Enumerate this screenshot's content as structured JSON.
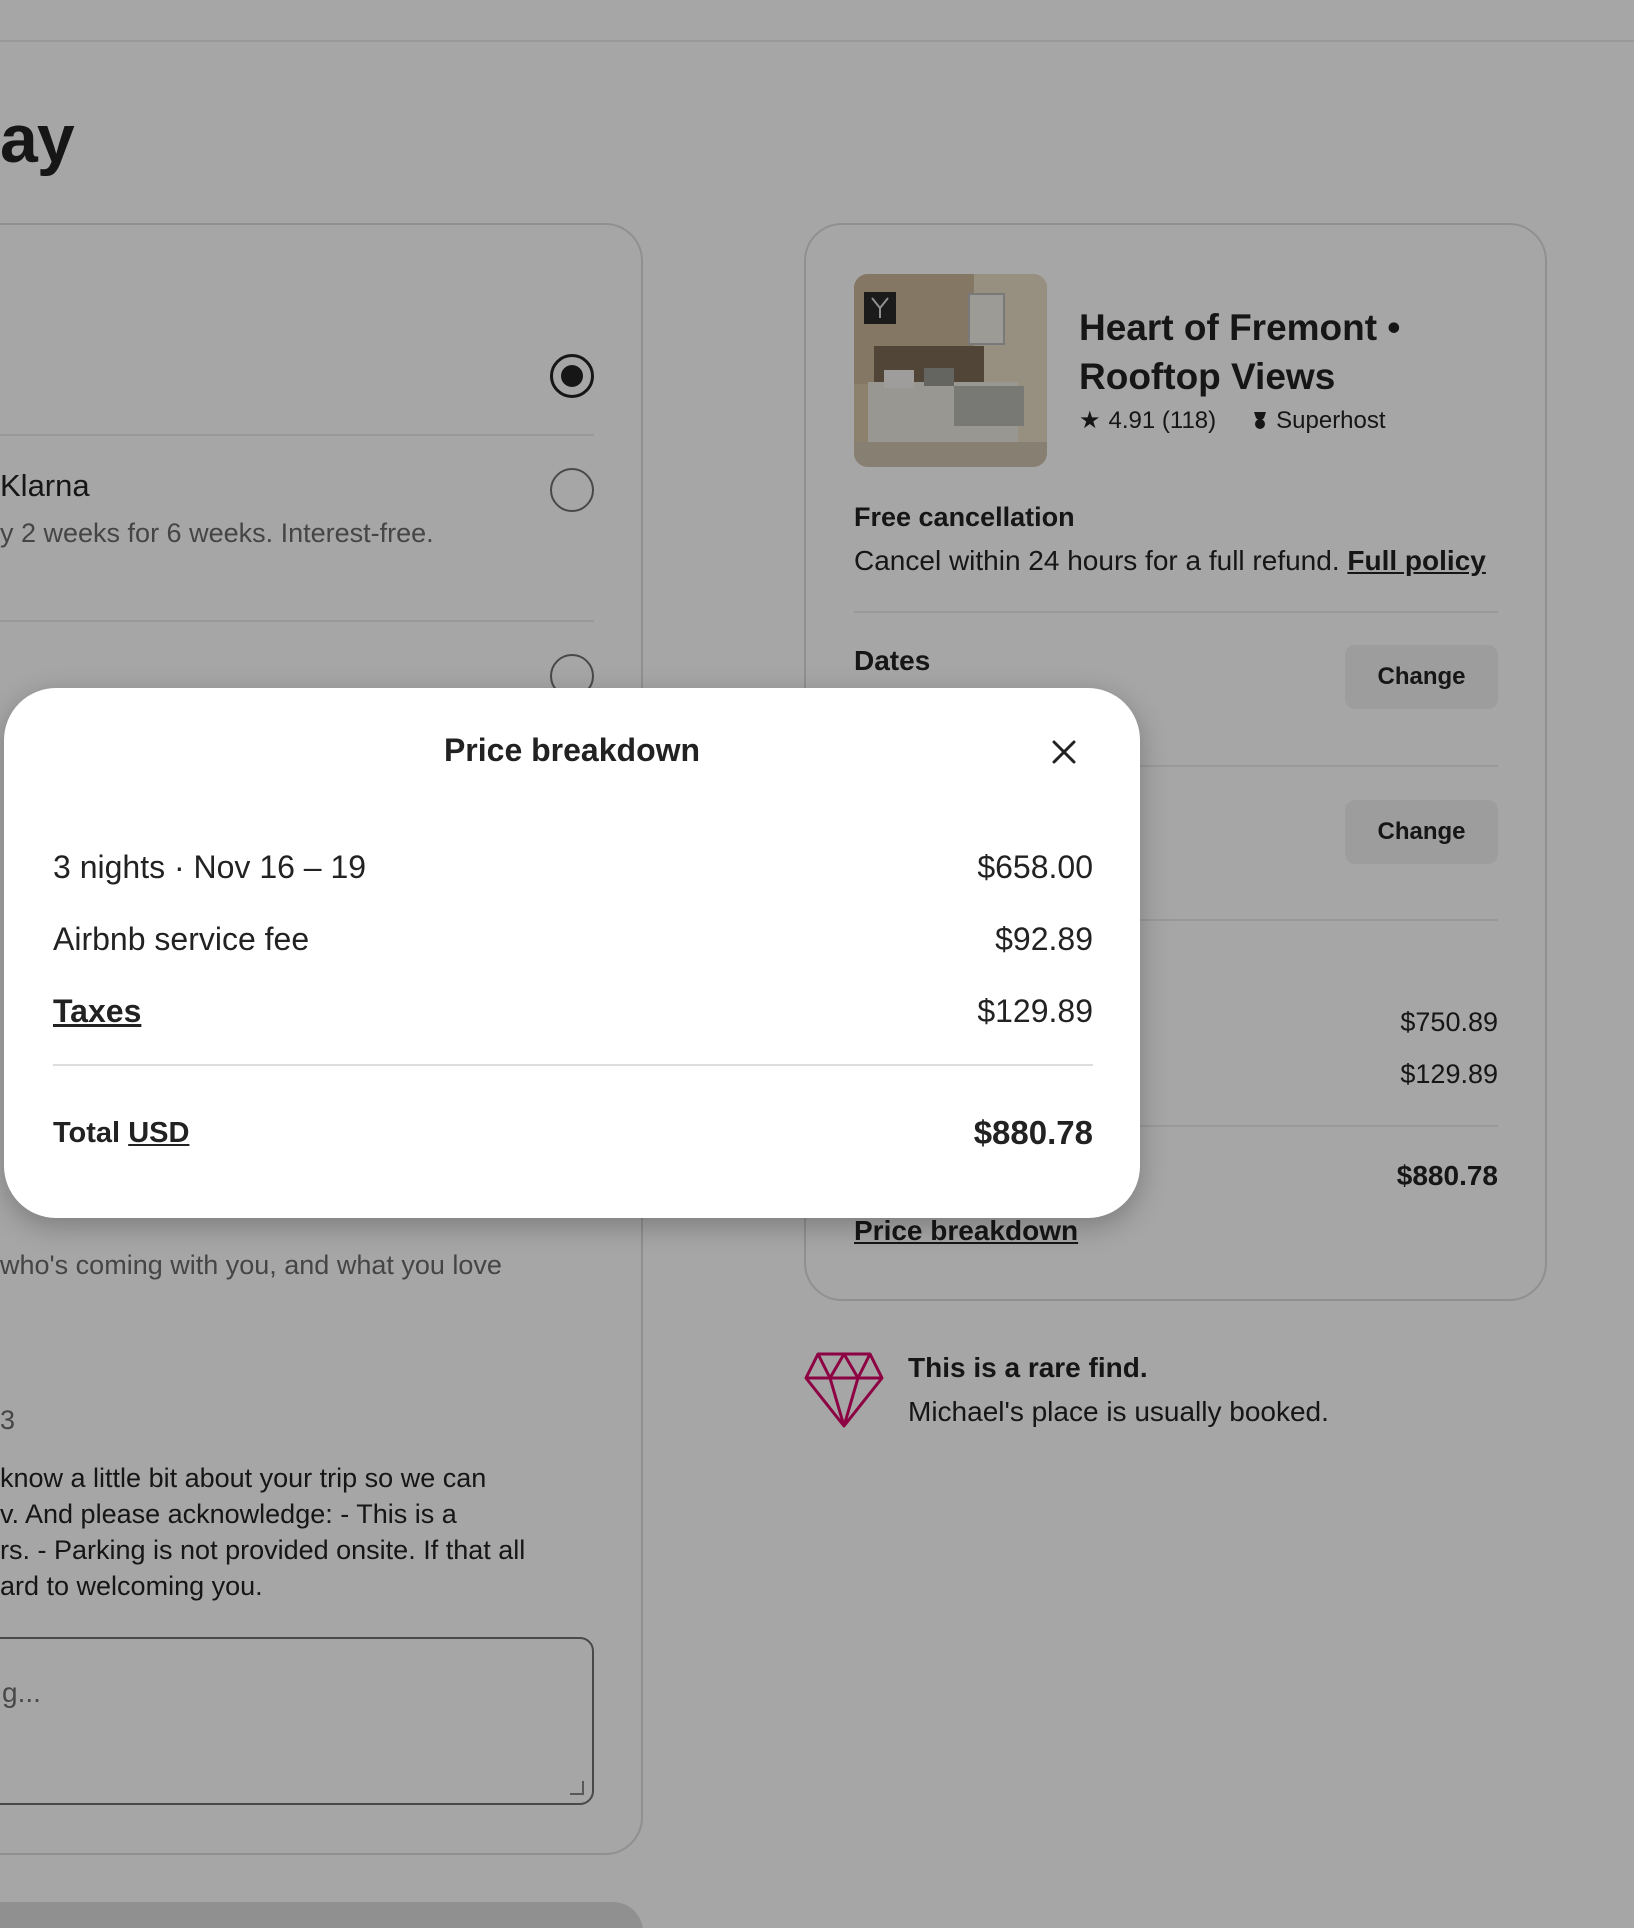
{
  "page": {
    "title_fragment": "ay"
  },
  "payment": {
    "klarna_title": "Klarna",
    "klarna_subtitle": "y 2 weeks for 6 weeks. Interest-free."
  },
  "message": {
    "prompt_fragment": "who's coming with you, and what you love",
    "host_number_fragment": "3",
    "host_message_lines": [
      "know a little bit about your trip so we can",
      "v. And please acknowledge: - This is a",
      "rs. - Parking is not provided onsite. If that all",
      "ard to welcoming you."
    ],
    "placeholder": "g..."
  },
  "listing": {
    "title": "Heart of Fremont • Rooftop Views",
    "rating": "4.91 (118)",
    "host_badge": "Superhost",
    "free_cancellation_title": "Free cancellation",
    "free_cancellation_text": "Cancel within 24 hours for a full refund.",
    "full_policy_link": "Full policy",
    "dates_label": "Dates",
    "change_label": "Change",
    "subtotal": "$750.89",
    "taxes": "$129.89",
    "total": "$880.78",
    "price_breakdown_link": "Price breakdown"
  },
  "rare_find": {
    "title": "This is a rare find.",
    "subtitle": "Michael's place is usually booked.",
    "accent_color": "#d70466"
  },
  "modal": {
    "title": "Price breakdown",
    "lines": [
      {
        "label": "3 nights · Nov 16 – 19",
        "amount": "$658.00"
      },
      {
        "label": "Airbnb service fee",
        "amount": "$92.89"
      },
      {
        "label": "Taxes",
        "amount": "$129.89"
      }
    ],
    "total_label": "Total",
    "total_currency": "USD",
    "total_amount": "$880.78"
  }
}
